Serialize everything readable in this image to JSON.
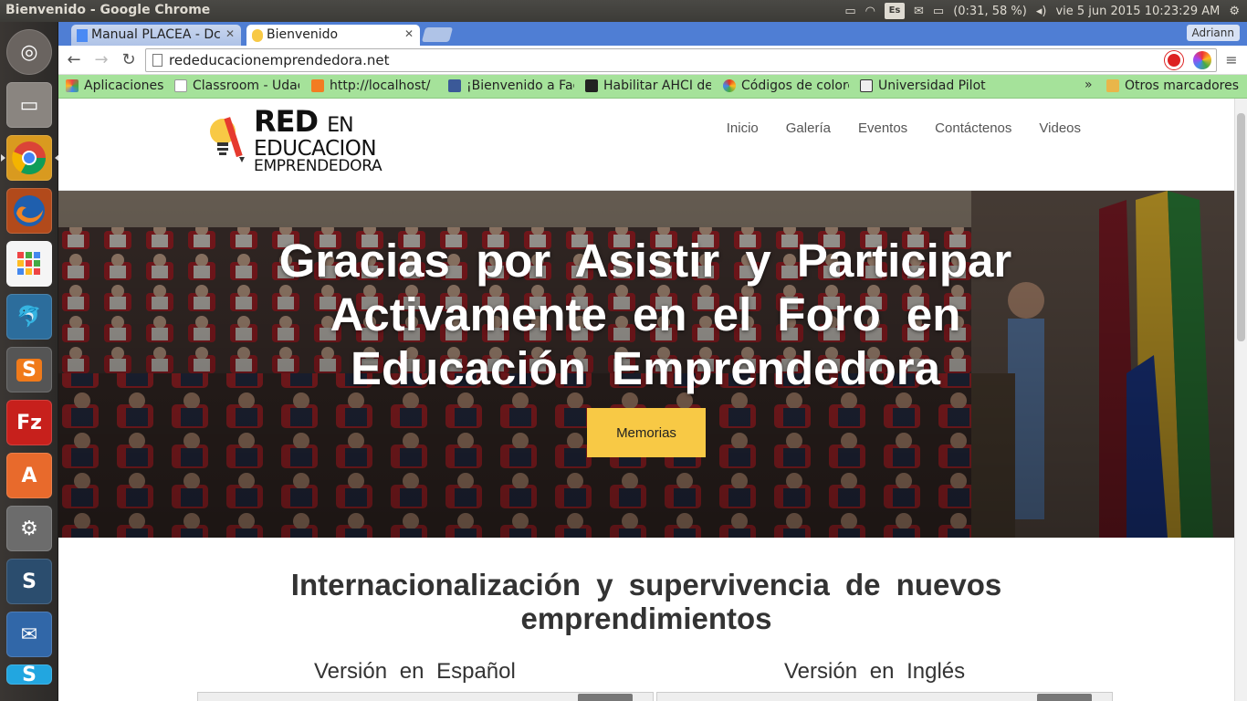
{
  "os": {
    "window_title": "Bienvenido - Google Chrome",
    "tray": {
      "keyboard_layout": "Es",
      "battery": "(0:31, 58 %)",
      "clock": "vie  5 jun 2015 10:23:29 AM"
    }
  },
  "launcher": {
    "items": [
      "dash-home",
      "files",
      "chrome",
      "firefox",
      "apps",
      "mysql-workbench",
      "sublime-text",
      "filezilla",
      "software-center",
      "system-settings",
      "scalable-sync",
      "thunderbird",
      "skype"
    ]
  },
  "browser": {
    "tabs": [
      {
        "label": "Manual PLACEA - Dc",
        "active": false
      },
      {
        "label": "Bienvenido",
        "active": true
      }
    ],
    "profile": "Adriann",
    "url": "rededucacionemprendedora.net",
    "bookmarks": [
      {
        "label": "Aplicaciones",
        "icon": "apps-icon",
        "color": "#4a8af4"
      },
      {
        "label": "Classroom - Udac",
        "icon": "page-icon",
        "color": "#ffffff"
      },
      {
        "label": "http://localhost/",
        "icon": "xampp-icon",
        "color": "#f37c22"
      },
      {
        "label": "¡Bienvenido a Fac",
        "icon": "facebook-icon",
        "color": "#3b5998"
      },
      {
        "label": "Habilitar AHCI de",
        "icon": "person-icon",
        "color": "#222222"
      },
      {
        "label": "Códigos de colore",
        "icon": "colorwheel-icon",
        "color": "#e2331f"
      },
      {
        "label": "Universidad Pilot",
        "icon": "up-icon",
        "color": "#eeeeee"
      }
    ],
    "bookmarks_more": "»",
    "other_bookmarks": "Otros marcadores"
  },
  "site": {
    "logo": {
      "line1": "RED",
      "line1b": "EN",
      "line2": "EDUCACION",
      "line3": "EMPRENDEDORA"
    },
    "nav": [
      "Inicio",
      "Galería",
      "Eventos",
      "Contáctenos",
      "Videos"
    ],
    "hero": {
      "title": "Gracias por Asistir y Participar Activamente en el Foro en Educación Emprendedora",
      "button": "Memorias"
    },
    "section_title": "Internacionalización y supervivencia de nuevos emprendimientos",
    "versions": {
      "spanish": "Versión en Español",
      "english": "Versión en Inglés"
    }
  },
  "colors": {
    "accent_button": "#f8c945",
    "bookmarks_bar": "#a5e29a",
    "tabstrip": "#4f7ed4"
  }
}
